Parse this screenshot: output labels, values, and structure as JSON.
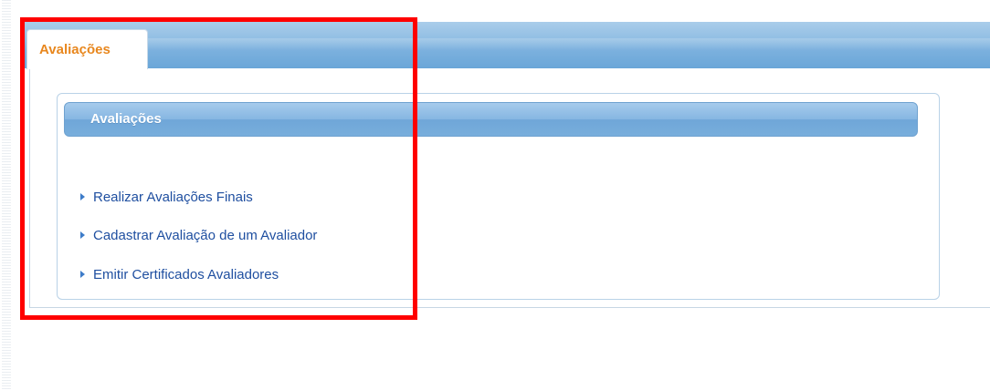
{
  "tabs": [
    {
      "label": "Avaliações",
      "active": true
    }
  ],
  "section": {
    "title": "Avaliações"
  },
  "menu": {
    "items": [
      {
        "label": "Realizar Avaliações Finais",
        "icon": "triangle-right-icon"
      },
      {
        "label": "Cadastrar Avaliação de um Avaliador",
        "icon": "triangle-right-icon"
      },
      {
        "label": "Emitir Certificados Avaliadores",
        "icon": "triangle-right-icon"
      }
    ]
  },
  "colors": {
    "tab_label": "#e8871e",
    "tab_band": "#7cb1de",
    "section_header": "#86b6e2",
    "link": "#1f4fa0",
    "arrow": "#3d7cc9",
    "highlight": "#ff0000"
  }
}
